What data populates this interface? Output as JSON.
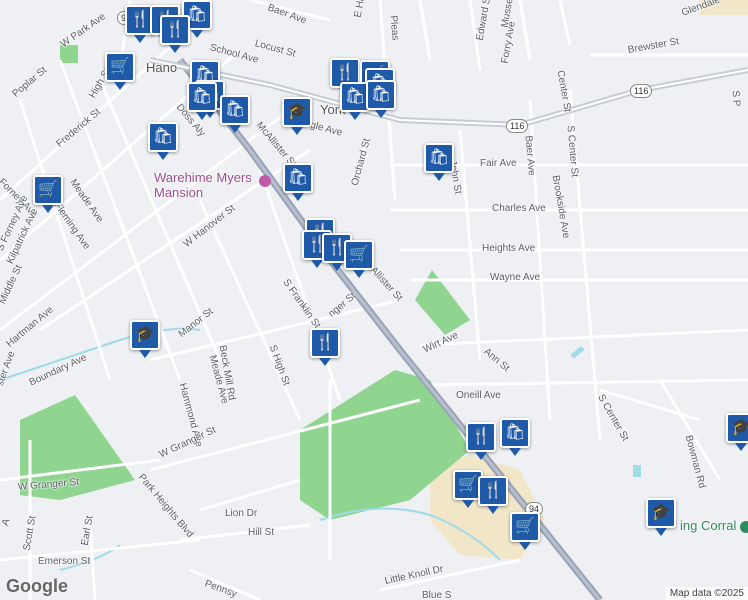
{
  "colors": {
    "background": "#eef0f3",
    "park": "#8fd48f",
    "water": "#9fdbe8",
    "highway": "#9aa3b5",
    "marker": "#1f5aa8",
    "school_area": "#f1e6c8"
  },
  "places": {
    "town": "Hano",
    "mansion": "Warehime Myers Mansion",
    "corral": "ing Corral"
  },
  "streets": {
    "baer_top": "Baer Ave",
    "locust": "Locust St",
    "school": "School Ave",
    "w_park": "W Park Ave",
    "poplar": "Poplar St",
    "high": "High St",
    "frederick": "Frederick St",
    "doss": "Doss Aly",
    "fourney": "Forney Ave",
    "meade": "Meade Ave",
    "fleming": "Fleming Ave",
    "mcallister": "McAllister St",
    "york": "York",
    "eagle": "agle Ave",
    "orchard": "Orchard St",
    "w_hanover": "W Hanover St",
    "john": "John St",
    "fair": "Fair Ave",
    "charles": "Charles Ave",
    "heights": "Heights Ave",
    "wayne": "Wayne Ave",
    "mcallister2": "Allister St",
    "s_franklin": "S Franklin St",
    "granger": "nger St",
    "kilpatrick": "Kilpatrick Ave",
    "s_fourney": "S Forney Ave",
    "middle": "Middle St",
    "hartman": "Hartman Ave",
    "manor": "Manor St",
    "meade2": "Meade Ave",
    "beck_mill": "Beck Mill Rd",
    "s_high": "S High St",
    "hammond": "Hammond Ave",
    "boundary": "Boundary Ave",
    "wirt": "Wirt Ave",
    "ann": "Ann St",
    "oneill": "Oneill Ave",
    "w_granger": "W Granger St",
    "w_granger2": "W Granger St",
    "park_heights": "Park Heights Blvd",
    "lion": "Lion Dr",
    "hill": "Hill St",
    "scott": "Scott St",
    "earl": "Earl St",
    "emerson": "Emerson St",
    "pennsy": "Pennsy",
    "little_knoll": "Little Knoll Dr",
    "blue": "Blue S",
    "s_center": "S Center St",
    "s_center2": "S Center St",
    "bowman": "Bowman Rd",
    "brookside": "Brookside Ave",
    "baer2": "Baer Ave",
    "center": "Center St",
    "brewster": "Brewster St",
    "glendale": "Glendale",
    "forry": "Forry Ave",
    "edward": "Edward St",
    "musseta": "Musseta",
    "e_han": "E Han",
    "pleas": "Pleas",
    "ster_ave": "ster Ave",
    "bl_ave": "A",
    "s_p": "S P"
  },
  "shields": {
    "r94_top": "94",
    "r116_a": "116",
    "r116_b": "116",
    "r94_bottom": "94"
  },
  "attribution": {
    "logo": "Google",
    "data": "Map data ©2025"
  },
  "icons": {
    "restaurant": "fork-knife-icon",
    "shopping": "shopping-bag-icon",
    "grocery": "shopping-cart-icon",
    "school": "school-icon"
  }
}
